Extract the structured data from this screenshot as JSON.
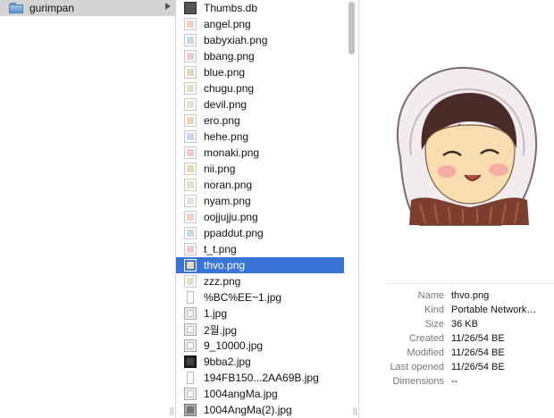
{
  "column1": {
    "folder_name": "gurimpan"
  },
  "column2": {
    "files": [
      {
        "name": "Thumbs.db",
        "icon": "db-file-icon"
      },
      {
        "name": "angel.png",
        "icon": "image-thumbnail-icon"
      },
      {
        "name": "babyxiah.png",
        "icon": "image-thumbnail-icon"
      },
      {
        "name": "bbang.png",
        "icon": "image-thumbnail-icon"
      },
      {
        "name": "blue.png",
        "icon": "image-thumbnail-icon"
      },
      {
        "name": "chugu.png",
        "icon": "image-thumbnail-icon"
      },
      {
        "name": "devil.png",
        "icon": "image-thumbnail-icon"
      },
      {
        "name": "ero.png",
        "icon": "image-thumbnail-icon"
      },
      {
        "name": "hehe.png",
        "icon": "image-thumbnail-icon"
      },
      {
        "name": "monaki.png",
        "icon": "image-thumbnail-icon"
      },
      {
        "name": "nii.png",
        "icon": "image-thumbnail-icon"
      },
      {
        "name": "noran.png",
        "icon": "image-thumbnail-icon"
      },
      {
        "name": "nyam.png",
        "icon": "image-thumbnail-icon"
      },
      {
        "name": "oojjujju.png",
        "icon": "image-thumbnail-icon"
      },
      {
        "name": "ppaddut.png",
        "icon": "image-thumbnail-icon"
      },
      {
        "name": "t_t.png",
        "icon": "image-thumbnail-icon"
      },
      {
        "name": "thvo.png",
        "icon": "image-thumbnail-icon",
        "selected": true
      },
      {
        "name": "zzz.png",
        "icon": "image-thumbnail-icon"
      },
      {
        "name": "%BC%EE~1.jpg",
        "icon": "blank-document-icon"
      },
      {
        "name": "1.jpg",
        "icon": "photo-thumbnail-icon"
      },
      {
        "name": "2월.jpg",
        "icon": "photo-thumbnail-icon"
      },
      {
        "name": "9_10000.jpg",
        "icon": "photo-thumbnail-icon"
      },
      {
        "name": "9bba2.jpg",
        "icon": "dark-thumbnail-icon"
      },
      {
        "name": "194FB150...2AA69B.jpg",
        "icon": "blank-document-icon"
      },
      {
        "name": "1004angMa.jpg",
        "icon": "photo-thumbnail-icon"
      },
      {
        "name": "1004AngMa(2).jpg",
        "icon": "mac-thumbnail-icon"
      }
    ]
  },
  "preview": {
    "info": [
      {
        "key": "Name",
        "value": "thvo.png"
      },
      {
        "key": "Kind",
        "value": "Portable Network…"
      },
      {
        "key": "Size",
        "value": "36 KB"
      },
      {
        "key": "Created",
        "value": "11/26/54 BE"
      },
      {
        "key": "Modified",
        "value": "11/26/54 BE"
      },
      {
        "key": "Last opened",
        "value": "11/26/54 BE"
      },
      {
        "key": "Dimensions",
        "value": "--"
      }
    ]
  },
  "colors": {
    "selection": "#3875d7",
    "folder_row": "#d4d4d4"
  }
}
